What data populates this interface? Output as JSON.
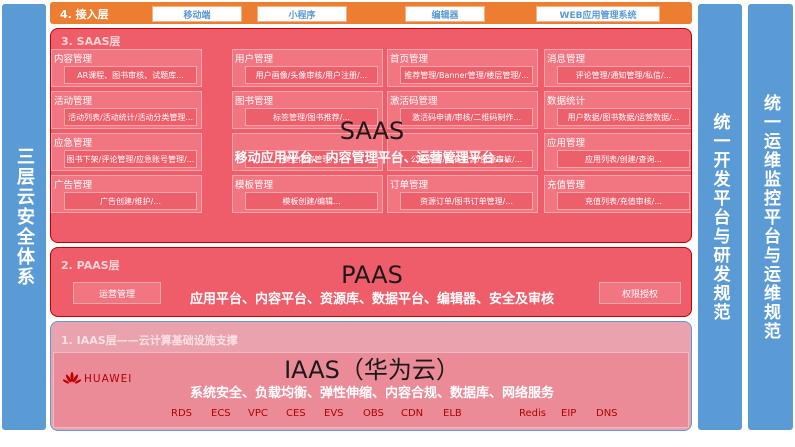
{
  "left_panel": {
    "title": "三层云安全体系"
  },
  "right_panels": {
    "dev_platform": "统一开发平台与研发规范",
    "ops_platform": "统一运维监控平台与运维规范"
  },
  "access_layer": {
    "title": "4. 接入层",
    "items": [
      "移动端",
      "小程序",
      "编辑器",
      "WEB应用管理系统"
    ]
  },
  "saas_layer": {
    "title": "3. SAAS层",
    "big_label": "SAAS",
    "subtitle": "移动应用平台、内容管理平台、运营管理平台...",
    "modules": [
      {
        "title": "内容管理",
        "detail": "AR课程、图书审核、试题库..."
      },
      {
        "title": "用户管理",
        "detail": "用户画像/头像审核/用户注册/..."
      },
      {
        "title": "首页管理",
        "detail": "推荐管理/Banner管理/楼层管理/..."
      },
      {
        "title": "消息管理",
        "detail": "评论管理/通知管理/私信/..."
      },
      {
        "title": "活动管理",
        "detail": "活动列表/活动统计/活动分类管理..."
      },
      {
        "title": "图书管理",
        "detail": "标签管理/图书推荐/..."
      },
      {
        "title": "激活码管理",
        "detail": "激活码申请/审核/二维码制作..."
      },
      {
        "title": "数据统计",
        "detail": "用户数据/图书数据/运营数据/..."
      },
      {
        "title": "应急管理",
        "detail": "图书下架/评论管理/应急账号管理/..."
      },
      {
        "title": "",
        "detail": "模型内容管理/..."
      },
      {
        "title": "",
        "detail": "公有资源/私有资源/资源审核/..."
      },
      {
        "title": "应用管理",
        "detail": "应用列表/创建/查询..."
      },
      {
        "title": "广告管理",
        "detail": "广告创建/维护/..."
      },
      {
        "title": "模板管理",
        "detail": "模板创建/编辑..."
      },
      {
        "title": "订单管理",
        "detail": "资源订单/图书订单管理/..."
      },
      {
        "title": "充值管理",
        "detail": "充值列表/充值审核/..."
      }
    ]
  },
  "paas_layer": {
    "title": "2. PAAS层",
    "big_label": "PAAS",
    "subtitle": "应用平台、内容平台、资源库、数据平台、编辑器、安全及审核",
    "chips": [
      "运营管理",
      "权限授权"
    ]
  },
  "iaas_layer": {
    "title": "1. IAAS层——云计算基础设施支撑",
    "vendor": "HUAWEI",
    "big_label": "IAAS（华为云）",
    "subtitle": "系统安全、负载均衡、弹性伸缩、内容合规、数据库、网络服务",
    "services": [
      "RDS",
      "ECS",
      "VPC",
      "CES",
      "EVS",
      "OBS",
      "CDN",
      "ELB",
      "Redis",
      "EIP",
      "DNS"
    ]
  },
  "colors": {
    "side_blue": "#5b9bd5",
    "access_orange": "#ed7d31",
    "layer_red": "#ef5d6a",
    "iaas_pink": "#e9a2ae",
    "huawei_red": "#b00000"
  }
}
